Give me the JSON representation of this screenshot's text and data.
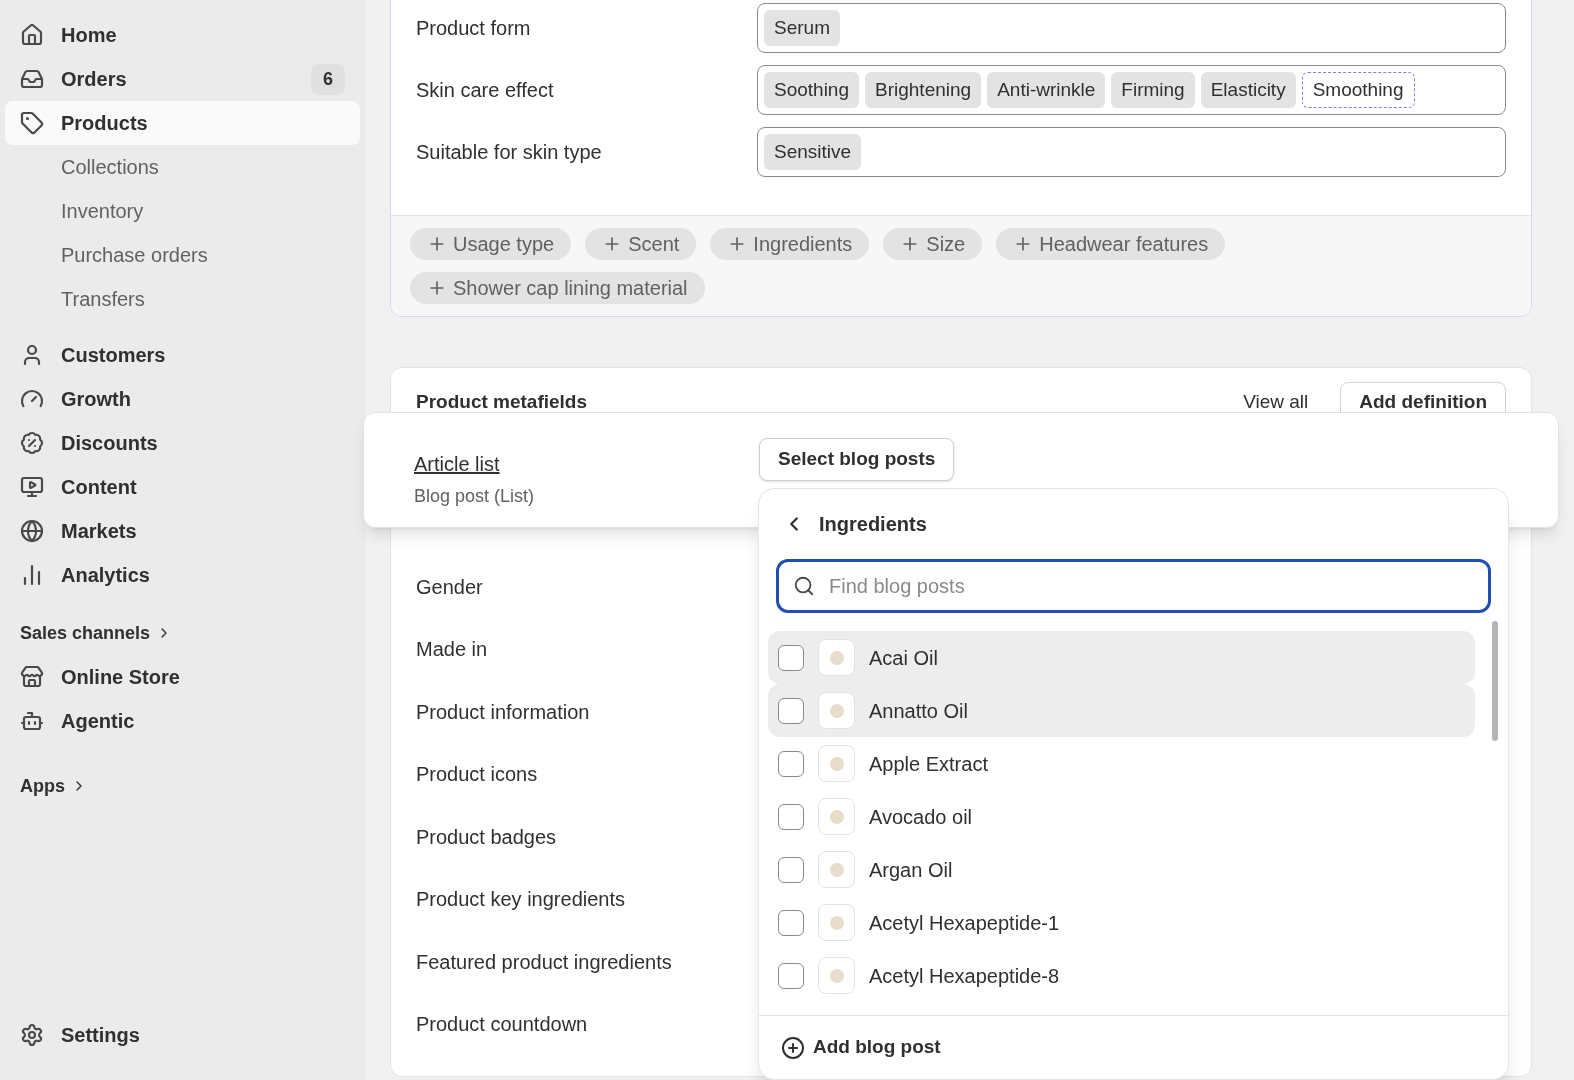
{
  "sidebar": {
    "nav": [
      {
        "label": "Home",
        "selected": false
      },
      {
        "label": "Orders",
        "selected": false,
        "badge": "6"
      },
      {
        "label": "Products",
        "selected": true,
        "children": [
          {
            "label": "Collections",
            "selected": false
          },
          {
            "label": "Inventory",
            "selected": false
          },
          {
            "label": "Purchase orders",
            "selected": false
          },
          {
            "label": "Transfers",
            "selected": false
          }
        ]
      },
      {
        "label": "Customers",
        "selected": false
      },
      {
        "label": "Growth",
        "selected": false
      },
      {
        "label": "Discounts",
        "selected": false
      },
      {
        "label": "Content",
        "selected": false
      },
      {
        "label": "Markets",
        "selected": false
      },
      {
        "label": "Analytics",
        "selected": false
      }
    ],
    "sales_channels": {
      "heading": "Sales channels",
      "items": [
        {
          "label": "Online Store",
          "selected": false
        },
        {
          "label": "Agentic",
          "selected": false
        }
      ]
    },
    "apps": {
      "heading": "Apps"
    },
    "settings": {
      "label": "Settings",
      "selected": false
    }
  },
  "attributes_card": {
    "rows": [
      {
        "label": "Product form",
        "values": [
          {
            "text": "Serum",
            "selected": false
          }
        ]
      },
      {
        "label": "Skin care effect",
        "values": [
          {
            "text": "Soothing",
            "selected": false
          },
          {
            "text": "Brightening",
            "selected": false
          },
          {
            "text": "Anti-wrinkle",
            "selected": false
          },
          {
            "text": "Firming",
            "selected": false
          },
          {
            "text": "Elasticity",
            "selected": false
          },
          {
            "text": "Smoothing",
            "selected": true
          }
        ]
      },
      {
        "label": "Suitable for skin type",
        "values": [
          {
            "text": "Sensitive",
            "selected": false
          }
        ]
      }
    ],
    "add_buttons": [
      "Usage type",
      "Scent",
      "Ingredients",
      "Size",
      "Headwear features",
      "Shower cap lining material"
    ]
  },
  "metafields_card": {
    "title": "Product metafields",
    "view_all": "View all",
    "add_definition": "Add definition",
    "rows": [
      "Gender",
      "Made in",
      "Product information",
      "Product icons",
      "Product badges",
      "Product key ingredients",
      "Featured product ingredients",
      "Product countdown"
    ]
  },
  "floating_row": {
    "name": "Article list",
    "type": "Blog post (List)",
    "button": "Select blog posts"
  },
  "picker": {
    "title": "Ingredients",
    "search": {
      "placeholder": "Find blog posts"
    },
    "items": [
      {
        "label": "Acai Oil",
        "checked": false,
        "highlighted": true
      },
      {
        "label": "Annatto Oil",
        "checked": false,
        "highlighted": true
      },
      {
        "label": "Apple Extract",
        "checked": false,
        "highlighted": false
      },
      {
        "label": "Avocado oil",
        "checked": false,
        "highlighted": false
      },
      {
        "label": "Argan Oil",
        "checked": false,
        "highlighted": false
      },
      {
        "label": "Acetyl Hexapeptide-1",
        "checked": false,
        "highlighted": false
      },
      {
        "label": "Acetyl Hexapeptide-8",
        "checked": false,
        "highlighted": false
      }
    ],
    "footer": "Add blog post"
  }
}
